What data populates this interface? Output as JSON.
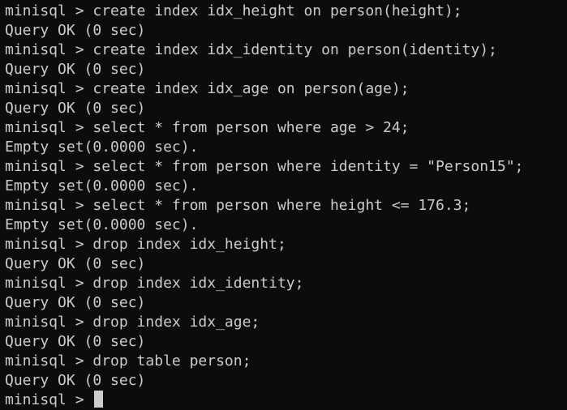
{
  "terminal": {
    "lines": [
      "minisql > create index idx_height on person(height);",
      "Query OK (0 sec)",
      "minisql > create index idx_identity on person(identity);",
      "Query OK (0 sec)",
      "minisql > create index idx_age on person(age);",
      "Query OK (0 sec)",
      "minisql > select * from person where age > 24;",
      "Empty set(0.0000 sec).",
      "minisql > select * from person where identity = \"Person15\";",
      "Empty set(0.0000 sec).",
      "minisql > select * from person where height <= 176.3;",
      "Empty set(0.0000 sec).",
      "minisql > drop index idx_height;",
      "Query OK (0 sec)",
      "minisql > drop index idx_identity;",
      "Query OK (0 sec)",
      "minisql > drop index idx_age;",
      "Query OK (0 sec)",
      "minisql > drop table person;",
      "Query OK (0 sec)"
    ],
    "prompt": "minisql > ",
    "colors": {
      "background": "#0c0c0c",
      "foreground": "#cccccc"
    }
  }
}
